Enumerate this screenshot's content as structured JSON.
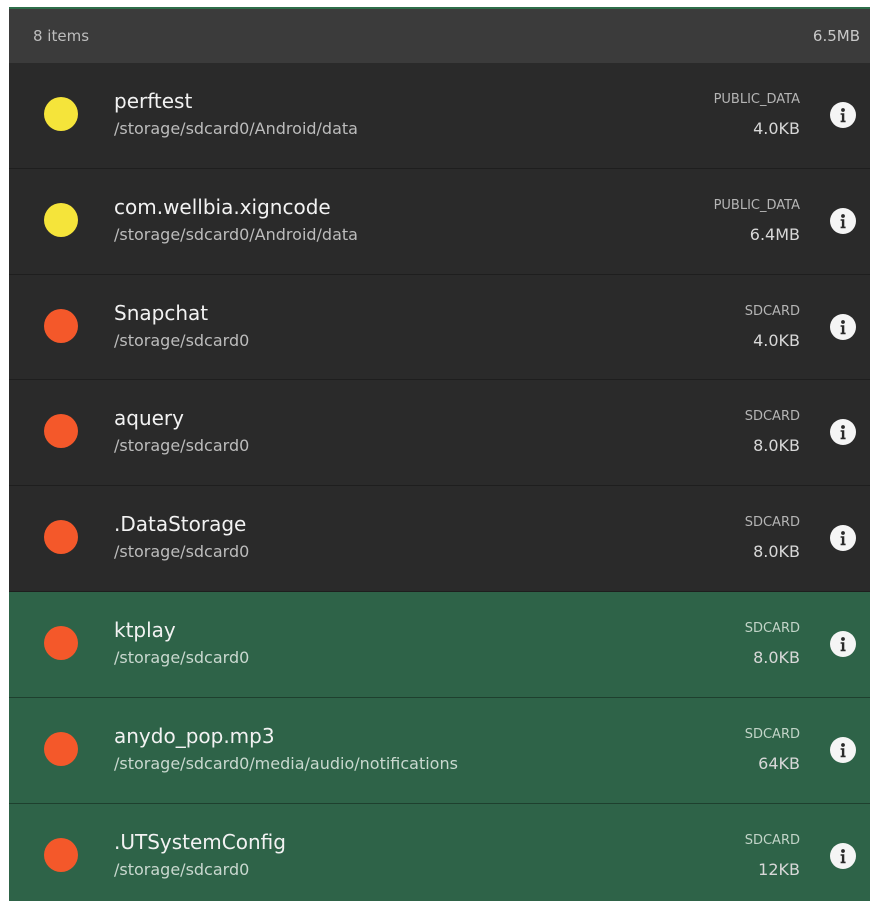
{
  "summary": {
    "count_label": "8 items",
    "total_size": "6.5MB"
  },
  "colors": {
    "public_data_dot": "#f5e43a",
    "sdcard_dot": "#f4582a",
    "selected_row": "#2e6348",
    "row": "#2a2a2a"
  },
  "items": [
    {
      "name": "perftest",
      "path": "/storage/sdcard0/Android/data",
      "location": "PUBLIC_DATA",
      "size": "4.0KB",
      "dot": "public_data_dot",
      "selected": false,
      "icon": "info-icon"
    },
    {
      "name": "com.wellbia.xigncode",
      "path": "/storage/sdcard0/Android/data",
      "location": "PUBLIC_DATA",
      "size": "6.4MB",
      "dot": "public_data_dot",
      "selected": false,
      "icon": "info-icon"
    },
    {
      "name": "Snapchat",
      "path": "/storage/sdcard0",
      "location": "SDCARD",
      "size": "4.0KB",
      "dot": "sdcard_dot",
      "selected": false,
      "icon": "info-icon"
    },
    {
      "name": "aquery",
      "path": "/storage/sdcard0",
      "location": "SDCARD",
      "size": "8.0KB",
      "dot": "sdcard_dot",
      "selected": false,
      "icon": "info-icon"
    },
    {
      "name": ".DataStorage",
      "path": "/storage/sdcard0",
      "location": "SDCARD",
      "size": "8.0KB",
      "dot": "sdcard_dot",
      "selected": false,
      "icon": "info-icon"
    },
    {
      "name": "ktplay",
      "path": "/storage/sdcard0",
      "location": "SDCARD",
      "size": "8.0KB",
      "dot": "sdcard_dot",
      "selected": true,
      "icon": "info-icon"
    },
    {
      "name": "anydo_pop.mp3",
      "path": "/storage/sdcard0/media/audio/notifications",
      "location": "SDCARD",
      "size": "64KB",
      "dot": "sdcard_dot",
      "selected": true,
      "icon": "info-icon"
    },
    {
      "name": ".UTSystemConfig",
      "path": "/storage/sdcard0",
      "location": "SDCARD",
      "size": "12KB",
      "dot": "sdcard_dot",
      "selected": true,
      "icon": "info-icon"
    }
  ]
}
